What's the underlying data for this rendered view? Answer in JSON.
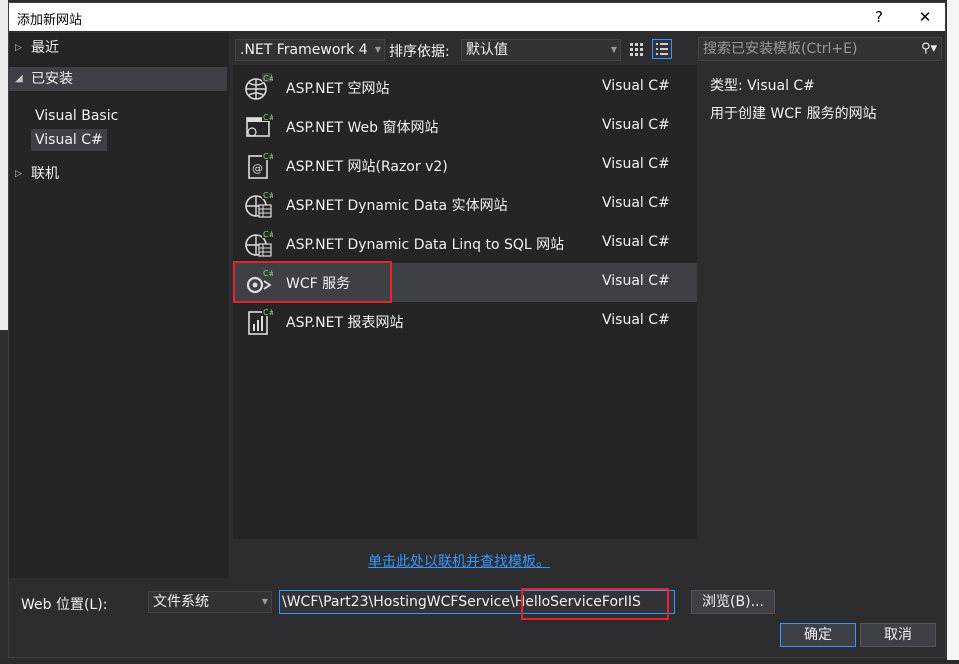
{
  "window": {
    "title": "添加新网站",
    "help_label": "?",
    "close_label": "✕"
  },
  "nav": {
    "recent": "最近",
    "installed": "已安装",
    "sub_items": [
      "Visual Basic",
      "Visual C#"
    ],
    "online": "联机"
  },
  "toolbar": {
    "framework": ".NET Framework 4",
    "sort_label": "排序依据:",
    "sort_value": "默认值",
    "search_placeholder": "搜索已安装模板(Ctrl+E)"
  },
  "templates": [
    {
      "name": "ASP.NET 空网站",
      "lang": "Visual C#",
      "icon": "globe-csharp-icon"
    },
    {
      "name": "ASP.NET Web 窗体网站",
      "lang": "Visual C#",
      "icon": "webform-csharp-icon"
    },
    {
      "name": "ASP.NET 网站(Razor v2)",
      "lang": "Visual C#",
      "icon": "razor-csharp-icon"
    },
    {
      "name": "ASP.NET Dynamic Data 实体网站",
      "lang": "Visual C#",
      "icon": "dynamic-data-icon"
    },
    {
      "name": "ASP.NET Dynamic Data Linq to SQL 网站",
      "lang": "Visual C#",
      "icon": "dynamic-data-linq-icon"
    },
    {
      "name": "WCF 服务",
      "lang": "Visual C#",
      "icon": "wcf-service-icon",
      "selected": true
    },
    {
      "name": "ASP.NET 报表网站",
      "lang": "Visual C#",
      "icon": "report-site-icon"
    }
  ],
  "online_link": "单击此处以联机并查找模板。",
  "details": {
    "type_line": "类型:  Visual C#",
    "description": "用于创建 WCF 服务的网站"
  },
  "bottom": {
    "location_label": "Web 位置(L):",
    "location_type": "文件系统",
    "path_prefix": "\\WCF\\Part23\\HostingWCFService\\",
    "path_suffix": "HelloServiceForIIS",
    "browse_label": "浏览(B)...",
    "ok_label": "确定",
    "cancel_label": "取消"
  },
  "colors": {
    "background": "#2d2d30",
    "panel": "#252526",
    "selection": "#3f3f46",
    "accent": "#3399ff",
    "highlight_box": "#e3242b"
  }
}
